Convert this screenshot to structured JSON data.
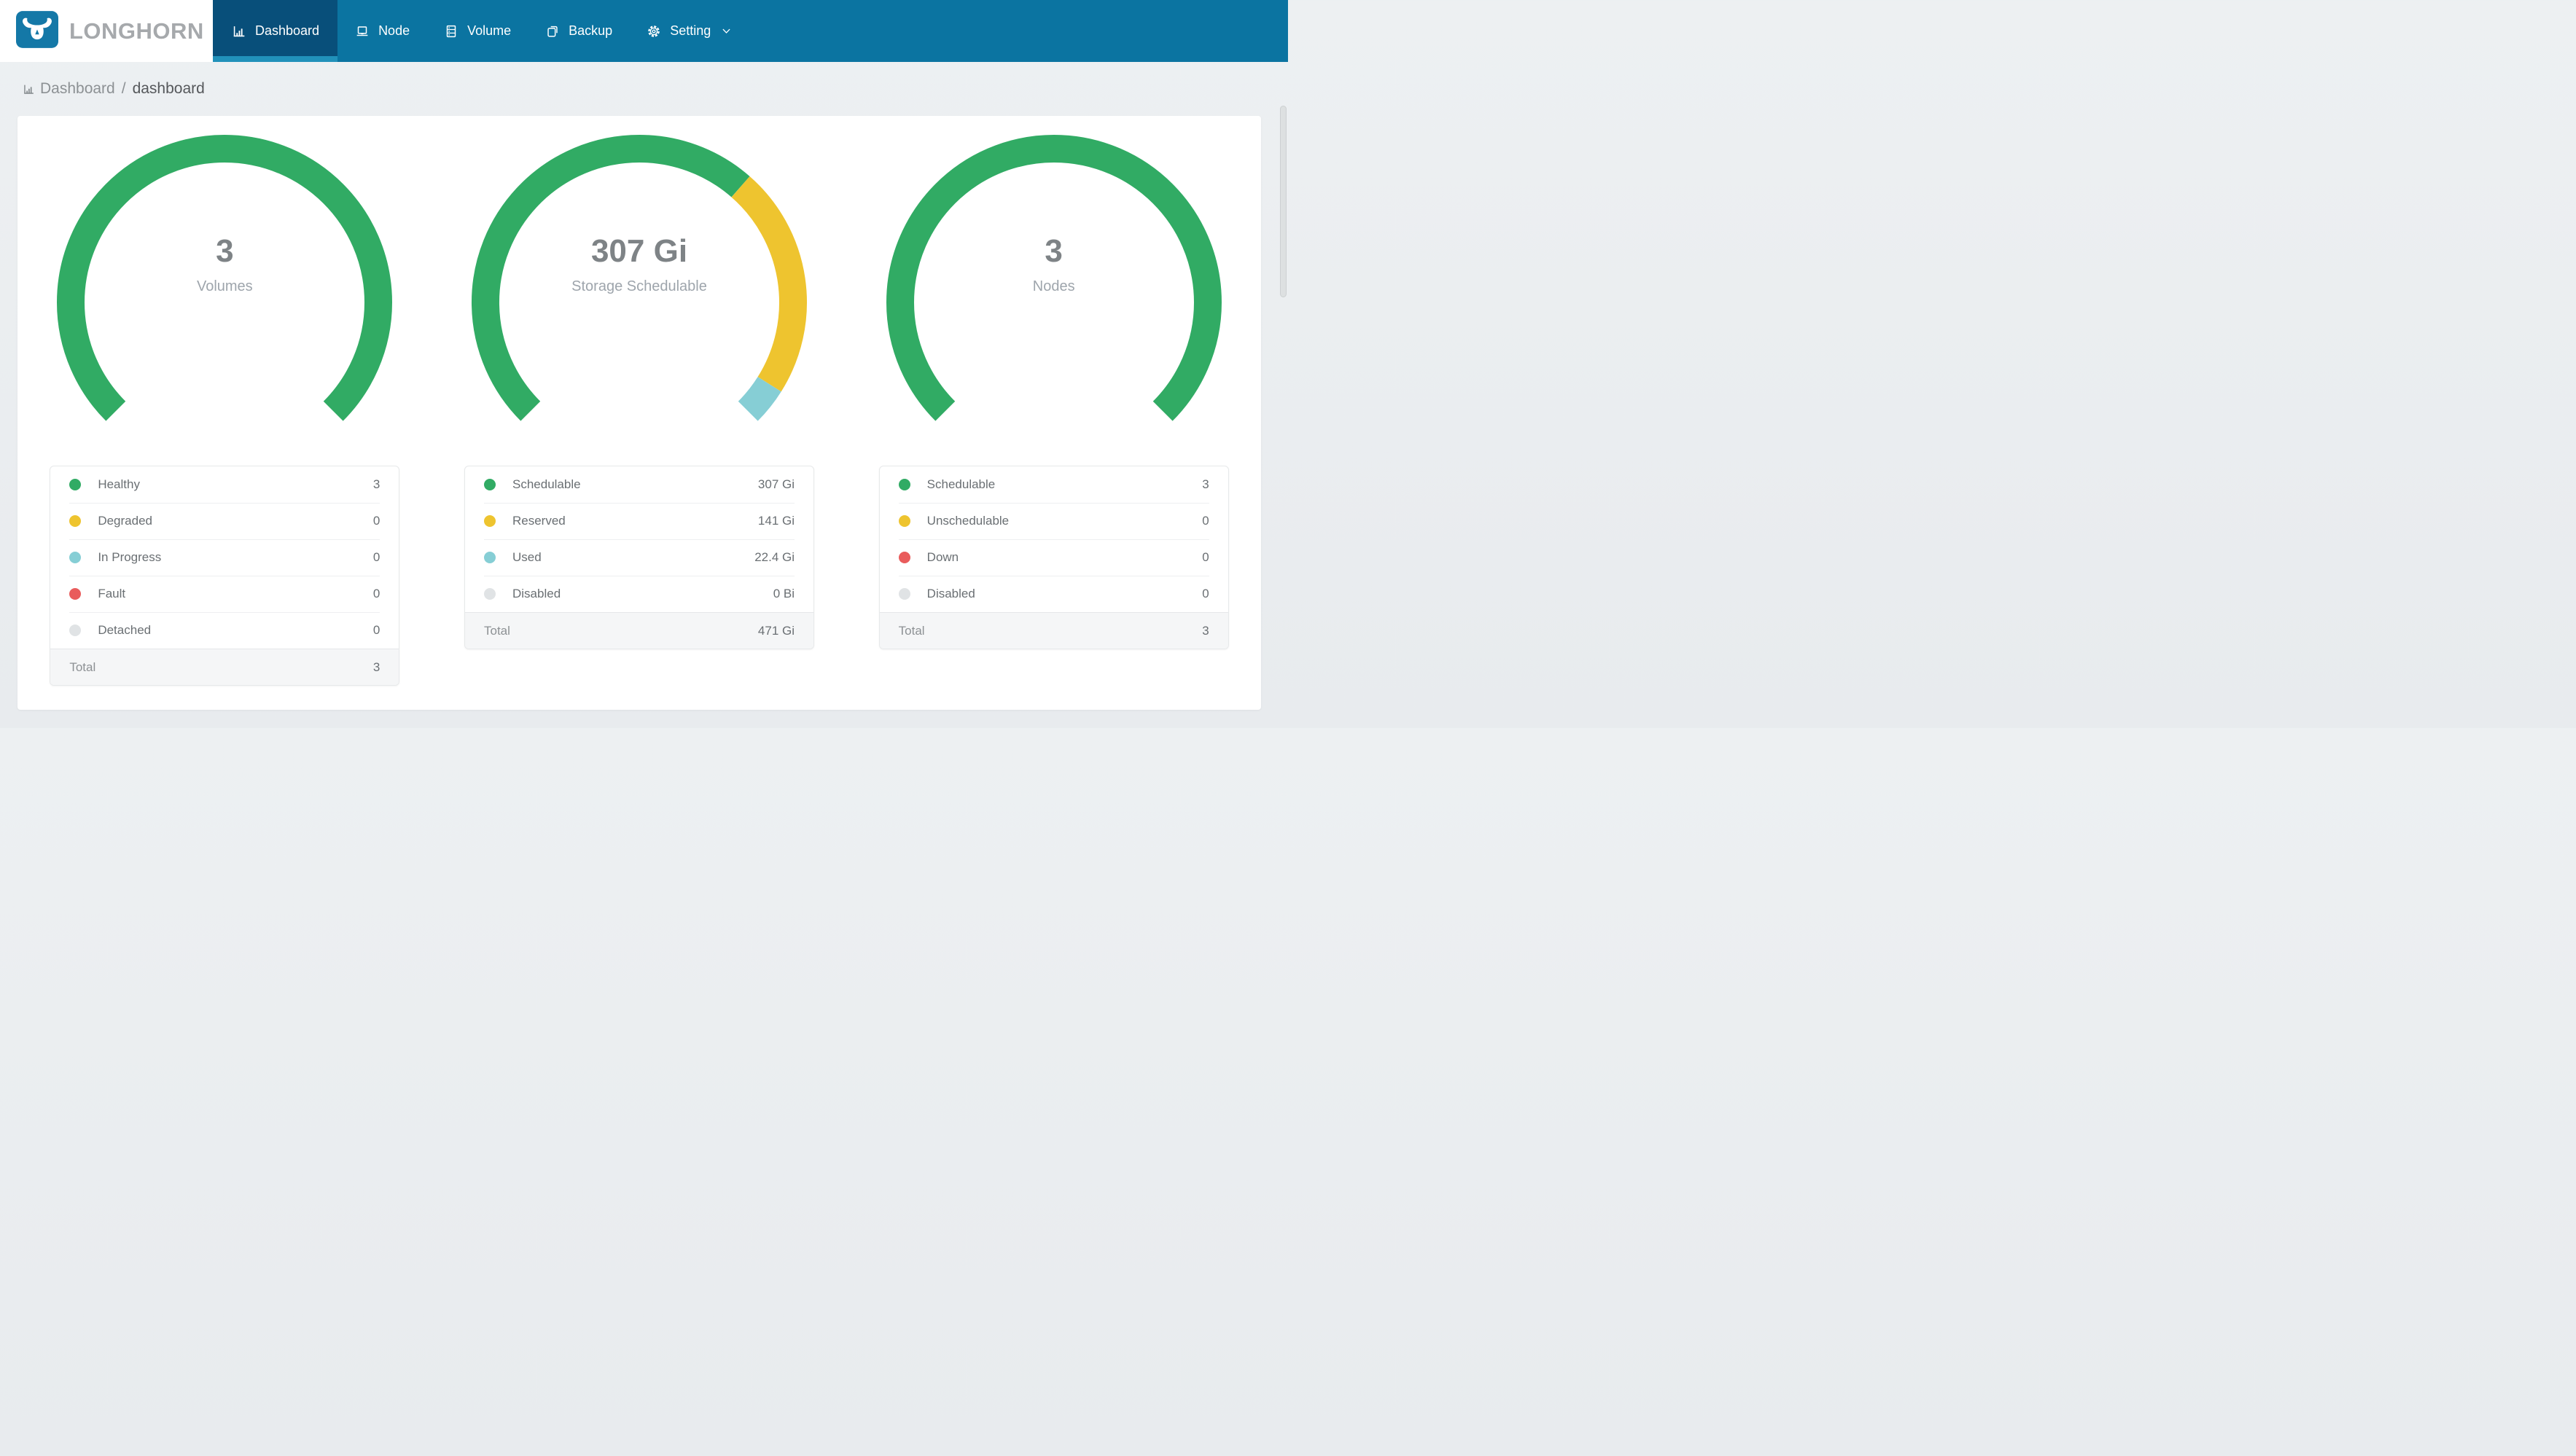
{
  "brand": {
    "name": "LONGHORN"
  },
  "nav": {
    "items": [
      {
        "label": "Dashboard",
        "icon": "dashboard-icon",
        "active": true
      },
      {
        "label": "Node",
        "icon": "node-icon",
        "active": false
      },
      {
        "label": "Volume",
        "icon": "volume-icon",
        "active": false
      },
      {
        "label": "Backup",
        "icon": "backup-icon",
        "active": false
      },
      {
        "label": "Setting",
        "icon": "setting-icon",
        "active": false,
        "has_dropdown": true
      }
    ]
  },
  "breadcrumb": {
    "section": "Dashboard",
    "separator": "/",
    "page": "dashboard"
  },
  "colors": {
    "header_bg": "#0B74A1",
    "active_tab_bg": "#084F7A",
    "active_tab_underline": "#2191BA",
    "logo_bg": "#1478A7",
    "page_bg": "#E9EDEF",
    "green": "#31AB64",
    "yellow": "#EEC42F",
    "teal": "#86CED5",
    "red": "#E95C5C",
    "gray": "#E0E3E5"
  },
  "chart_data": [
    {
      "type": "gauge",
      "title": "Volumes",
      "center_value": "3",
      "center_label": "Volumes",
      "start_angle": 225,
      "sweep": 270,
      "segments": [
        {
          "label": "Healthy",
          "value": 3,
          "color": "#31AB64"
        },
        {
          "label": "Degraded",
          "value": 0,
          "color": "#EEC42F"
        },
        {
          "label": "In Progress",
          "value": 0,
          "color": "#86CED5"
        },
        {
          "label": "Fault",
          "value": 0,
          "color": "#E95C5C"
        },
        {
          "label": "Detached",
          "value": 0,
          "color": "#E0E3E5"
        }
      ]
    },
    {
      "type": "gauge",
      "title": "Storage Schedulable",
      "center_value": "307 Gi",
      "center_label": "Storage Schedulable",
      "start_angle": 225,
      "sweep": 270,
      "segments": [
        {
          "label": "Schedulable",
          "value": 307,
          "color": "#31AB64"
        },
        {
          "label": "Reserved",
          "value": 141,
          "color": "#EEC42F"
        },
        {
          "label": "Used",
          "value": 22.4,
          "color": "#86CED5"
        },
        {
          "label": "Disabled",
          "value": 0,
          "color": "#E0E3E5"
        }
      ]
    },
    {
      "type": "gauge",
      "title": "Nodes",
      "center_value": "3",
      "center_label": "Nodes",
      "start_angle": 225,
      "sweep": 270,
      "segments": [
        {
          "label": "Schedulable",
          "value": 3,
          "color": "#31AB64"
        },
        {
          "label": "Unschedulable",
          "value": 0,
          "color": "#EEC42F"
        },
        {
          "label": "Down",
          "value": 0,
          "color": "#E95C5C"
        },
        {
          "label": "Disabled",
          "value": 0,
          "color": "#E0E3E5"
        }
      ]
    }
  ],
  "legend_tables": [
    {
      "rows": [
        {
          "label": "Healthy",
          "value": "3",
          "color": "#31AB64"
        },
        {
          "label": "Degraded",
          "value": "0",
          "color": "#EEC42F"
        },
        {
          "label": "In Progress",
          "value": "0",
          "color": "#86CED5"
        },
        {
          "label": "Fault",
          "value": "0",
          "color": "#E95C5C"
        },
        {
          "label": "Detached",
          "value": "0",
          "color": "#E0E3E5"
        }
      ],
      "total": {
        "label": "Total",
        "value": "3"
      }
    },
    {
      "rows": [
        {
          "label": "Schedulable",
          "value": "307 Gi",
          "color": "#31AB64"
        },
        {
          "label": "Reserved",
          "value": "141 Gi",
          "color": "#EEC42F"
        },
        {
          "label": "Used",
          "value": "22.4 Gi",
          "color": "#86CED5"
        },
        {
          "label": "Disabled",
          "value": "0 Bi",
          "color": "#E0E3E5"
        }
      ],
      "total": {
        "label": "Total",
        "value": "471 Gi"
      }
    },
    {
      "rows": [
        {
          "label": "Schedulable",
          "value": "3",
          "color": "#31AB64"
        },
        {
          "label": "Unschedulable",
          "value": "0",
          "color": "#EEC42F"
        },
        {
          "label": "Down",
          "value": "0",
          "color": "#E95C5C"
        },
        {
          "label": "Disabled",
          "value": "0",
          "color": "#E0E3E5"
        }
      ],
      "total": {
        "label": "Total",
        "value": "3"
      }
    }
  ]
}
